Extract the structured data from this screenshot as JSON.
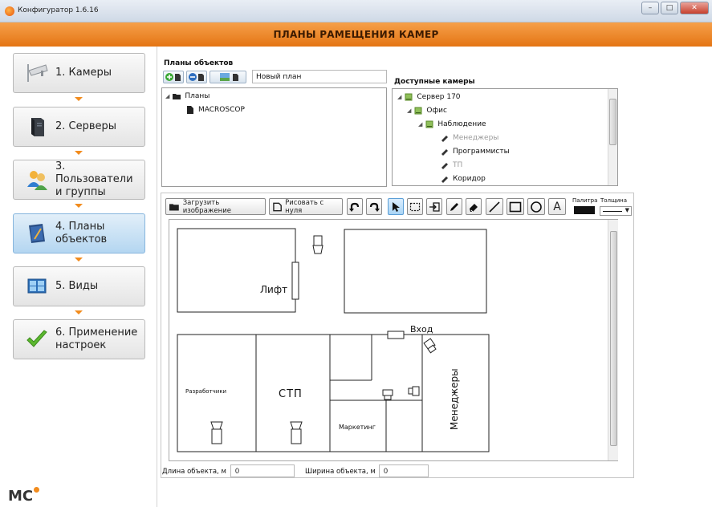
{
  "window": {
    "title": "Конфигуратор 1.6.16",
    "header": "ПЛАНЫ РАМЕЩЕНИЯ КАМЕР",
    "buttons": [
      "–",
      "□",
      "✕"
    ]
  },
  "sidebar": {
    "steps": [
      {
        "line1": "1. Камеры",
        "line2": ""
      },
      {
        "line1": "2. Серверы",
        "line2": ""
      },
      {
        "line1": "3. Пользователи",
        "line2": "и группы"
      },
      {
        "line1": "4. Планы",
        "line2": "объектов"
      },
      {
        "line1": "5. Виды",
        "line2": ""
      },
      {
        "line1": "6. Применение",
        "line2": "настроек"
      }
    ],
    "active_step": 3,
    "logo": "MC"
  },
  "plans": {
    "title": "Планы объектов",
    "new_plan_value": "Новый план",
    "tree": [
      {
        "label": "Планы",
        "level": 0,
        "expanded": true,
        "icon": "folder-icon"
      },
      {
        "label": "MACROSCOP",
        "level": 1,
        "icon": "document-icon"
      }
    ]
  },
  "cameras": {
    "title": "Доступные камеры",
    "tree": [
      {
        "label": "Сервер 170",
        "level": 0,
        "icon": "server-icon",
        "gray": false
      },
      {
        "label": "Офис",
        "level": 1,
        "icon": "server-icon",
        "gray": false
      },
      {
        "label": "Наблюдение",
        "level": 2,
        "icon": "server-icon",
        "gray": false
      },
      {
        "label": "Менеджеры",
        "level": 3,
        "icon": "camera-icon",
        "gray": true
      },
      {
        "label": "Программисты",
        "level": 3,
        "icon": "camera-icon",
        "gray": false
      },
      {
        "label": "ТП",
        "level": 3,
        "icon": "camera-icon",
        "gray": true
      },
      {
        "label": "Коридор",
        "level": 3,
        "icon": "camera-icon",
        "gray": false
      }
    ]
  },
  "editor": {
    "load_image": "Загрузить изображение",
    "draw_from_scratch": "Рисовать с нуля",
    "palette": "Палитра",
    "thickness": "Толщина",
    "palette_color": "#111111",
    "text_tool": "A"
  },
  "floorplan": {
    "labels": {
      "lift": "Лифт",
      "entrance": "Вход",
      "developers": "Разработчики",
      "stp": "СТП",
      "marketing": "Маркетинг",
      "managers": "Менеджеры"
    }
  },
  "object": {
    "length_label": "Длина объекта, м",
    "length_value": "0",
    "width_label": "Ширина объекта, м",
    "width_value": "0"
  }
}
